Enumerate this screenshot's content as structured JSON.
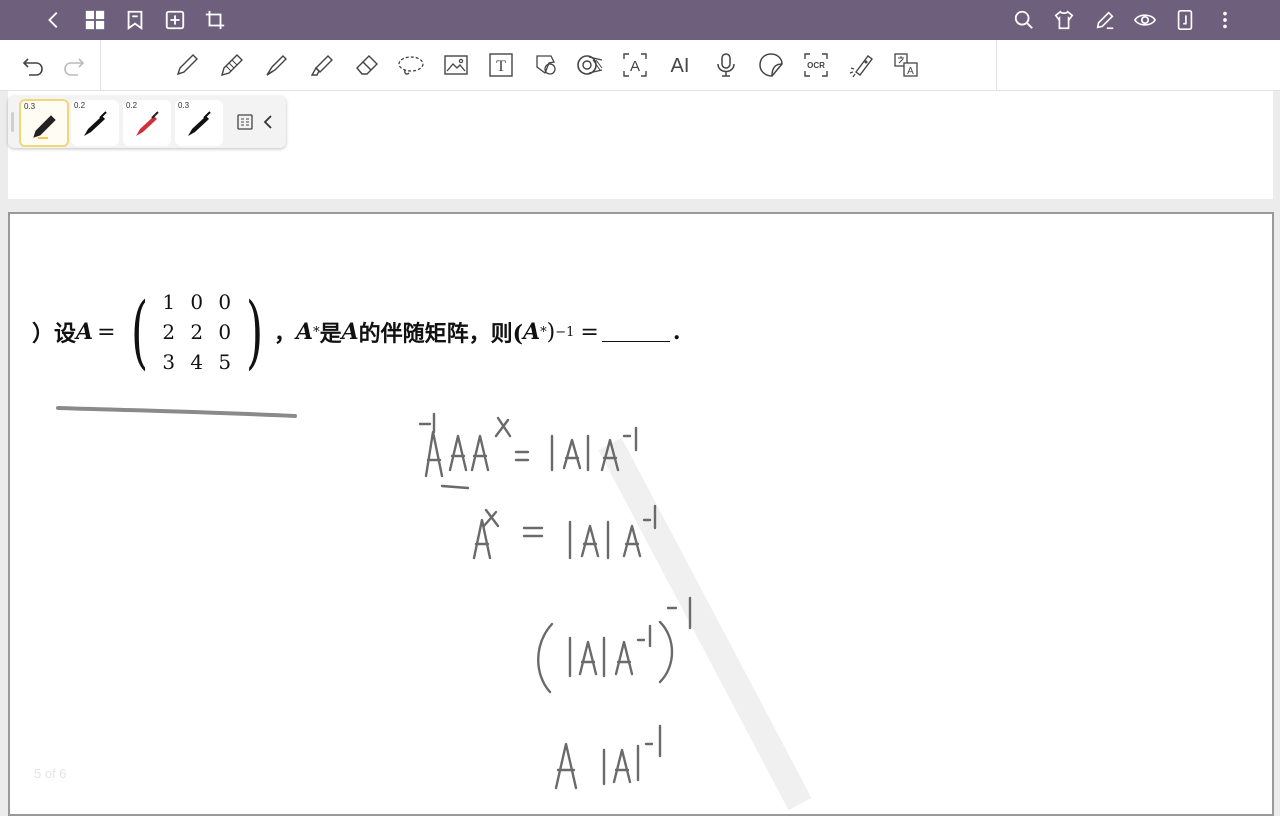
{
  "topbar": {
    "color": "#6e5f7c",
    "left_icons": [
      "back-icon",
      "grid-icon",
      "bookmark-icon",
      "add-page-icon",
      "crop-icon"
    ],
    "right_icons": [
      "search-icon",
      "shirt-icon",
      "pen-edit-icon",
      "eye-icon",
      "page-fit-icon",
      "more-icon"
    ]
  },
  "toolbar": {
    "tools": [
      "undo-icon",
      "redo-icon",
      "ball-pen-icon",
      "pencil-icon",
      "fountain-pen-icon",
      "highlighter-icon",
      "eraser-icon",
      "lasso-icon",
      "image-icon",
      "text-icon",
      "shape-icon",
      "tape-icon",
      "text-recognition-icon",
      "ai-icon",
      "microphone-icon",
      "sticker-icon",
      "ocr-icon",
      "laser-pointer-icon",
      "translate-icon"
    ],
    "ocr_label": "OCR",
    "text_label": "T",
    "ai_label": "AI",
    "recog_label": "A",
    "translate_label": "A"
  },
  "pencase": {
    "pens": [
      {
        "size": "0.3",
        "color": "#222222",
        "active": true
      },
      {
        "size": "0.2",
        "color": "#111111",
        "active": false
      },
      {
        "size": "0.2",
        "color": "#d0303a",
        "active": false
      },
      {
        "size": "0.3",
        "color": "#111111",
        "active": false
      }
    ]
  },
  "problem": {
    "prefix": "）设",
    "var_A": "A",
    "equals": "=",
    "matrix": [
      [
        "1",
        "0",
        "0"
      ],
      [
        "2",
        "2",
        "0"
      ],
      [
        "3",
        "4",
        "5"
      ]
    ],
    "comma": "，",
    "astar_A": "A",
    "star": "*",
    "text_mid": "是",
    "var_A2": "A",
    "text_mid2": "的伴随矩阵，则(",
    "astar_A3": "A",
    "star2": "*",
    "close_paren": ")",
    "exp": "−1",
    "equals2": "=",
    "period": "."
  },
  "page": {
    "number": "5 of 6"
  },
  "handwriting": {
    "line1": "A⁻¹AA* = |A| A⁻¹",
    "line2": "A* = |A| A⁻¹",
    "line3": "(|A|A⁻¹)⁻¹",
    "line4": "A |A|⁻¹"
  }
}
